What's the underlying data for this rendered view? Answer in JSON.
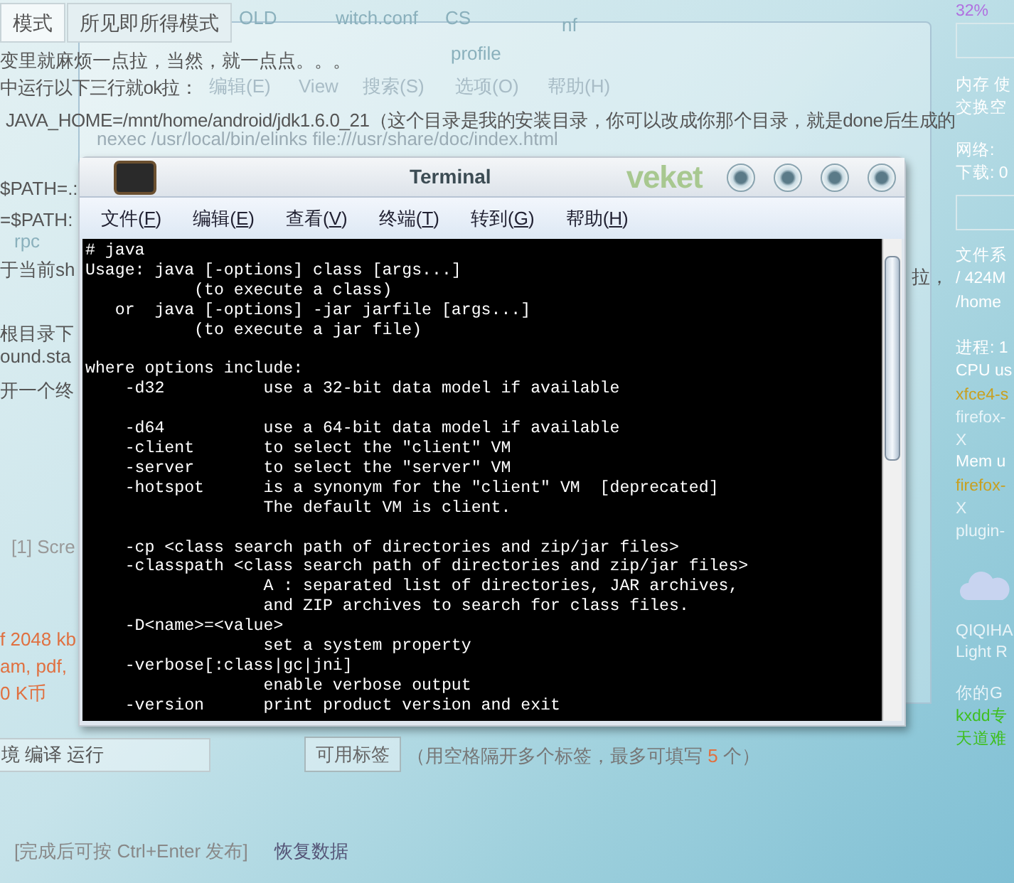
{
  "page_tabs": [
    {
      "label": "模式",
      "selected": true
    },
    {
      "label": "所见即所得模式",
      "selected": false
    }
  ],
  "desktop_labels": [
    "OLD",
    "witch.conf",
    "CS",
    "nf",
    "profile",
    "rpc"
  ],
  "article_lines": [
    {
      "text": "变里就麻烦一点拉，当然，就一点点。。。",
      "kind": "plain"
    },
    {
      "text": "中运行以下三行就ok拉：",
      "kind": "plain"
    },
    {
      "text": "JAVA_HOME=/mnt/home/android/jdk1.6.0_21（这个目录是我的安装目录，你可以改成你那个目录，就是done后生成的",
      "kind": "plain"
    },
    {
      "text": "$PATH=.:",
      "kind": "plain"
    },
    {
      "text": "=$PATH:",
      "kind": "plain"
    },
    {
      "text": "于当前sh",
      "kind": "plain"
    },
    {
      "text": "根目录下",
      "kind": "plain"
    },
    {
      "text": "ound.sta",
      "kind": "plain"
    },
    {
      "text": "开一个终",
      "kind": "plain"
    },
    {
      "text": "[1] Scre",
      "kind": "plain"
    },
    {
      "text": "f 2048 kb",
      "kind": "note"
    },
    {
      "text": "am, pdf,",
      "kind": "note"
    },
    {
      "text": "0 K币",
      "kind": "note"
    },
    {
      "text": "拉，",
      "kind": "plain"
    }
  ],
  "editor_window": {
    "menus": [
      "编辑(E)",
      "View",
      "搜索(S)",
      "选项(O)",
      "帮助(H)"
    ],
    "command": "nexec /usr/local/bin/elinks file:///usr/share/doc/index.html"
  },
  "tags_row": {
    "field_value": "境 编译 运行",
    "button": "可用标签",
    "hint_before": "（用空格隔开多个标签，最多可填写",
    "hint_count": "5",
    "hint_after": "个）"
  },
  "footer": {
    "shortcut_hint": "[完成后可按 Ctrl+Enter 发布]",
    "restore_link": "恢复数据"
  },
  "conky": [
    {
      "text": "32%",
      "color": "#b070e0"
    },
    {
      "text": "内存 使",
      "color": "#ffffff"
    },
    {
      "text": "交换空",
      "color": "#ffffff"
    },
    {
      "text": "网络:",
      "color": "#ffffff"
    },
    {
      "text": "下载: 0",
      "color": "#ffffff"
    },
    {
      "text": "文件系",
      "color": "#ffffff"
    },
    {
      "text": "/ 424M",
      "color": "#ffffff"
    },
    {
      "text": "/home",
      "color": "#ffffff"
    },
    {
      "text": "进程: 1",
      "color": "#ffffff"
    },
    {
      "text": "CPU us",
      "color": "#ffffff"
    },
    {
      "text": "xfce4-s",
      "color": "#c8a020"
    },
    {
      "text": "firefox-",
      "color": "#e8f4f8"
    },
    {
      "text": "X",
      "color": "#e8f4f8"
    },
    {
      "text": "Mem u",
      "color": "#ffffff"
    },
    {
      "text": "firefox-",
      "color": "#c8a020"
    },
    {
      "text": "X",
      "color": "#e8f4f8"
    },
    {
      "text": "plugin-",
      "color": "#e8f4f8"
    },
    {
      "text": "QIQIHA",
      "color": "#e8f4f8"
    },
    {
      "text": "Light R",
      "color": "#e8f4f8"
    },
    {
      "text": "你的G",
      "color": "#e8f4f8"
    },
    {
      "text": "kxdd专",
      "color": "#3fbf20"
    },
    {
      "text": "天道难",
      "color": "#3fbf20"
    }
  ],
  "terminal": {
    "title": "Terminal",
    "logo": "veket",
    "menus": [
      "文件(F)",
      "编辑(E)",
      "查看(V)",
      "终端(T)",
      "转到(G)",
      "帮助(H)"
    ],
    "blocks": [
      [
        "# java",
        "Usage: java [-options] class [args...]",
        "           (to execute a class)",
        "   or  java [-options] -jar jarfile [args...]",
        "           (to execute a jar file)"
      ],
      [
        "where options include:",
        "    -d32          use a 32-bit data model if available"
      ],
      [
        "    -d64          use a 64-bit data model if available",
        "    -client       to select the \"client\" VM",
        "    -server       to select the \"server\" VM",
        "    -hotspot      is a synonym for the \"client\" VM  [deprecated]",
        "                  The default VM is client."
      ],
      [
        "    -cp <class search path of directories and zip/jar files>",
        "    -classpath <class search path of directories and zip/jar files>",
        "                  A : separated list of directories, JAR archives,",
        "                  and ZIP archives to search for class files.",
        "    -D<name>=<value>",
        "                  set a system property",
        "    -verbose[:class|gc|jni]",
        "                  enable verbose output",
        "    -version      print product version and exit"
      ]
    ]
  }
}
